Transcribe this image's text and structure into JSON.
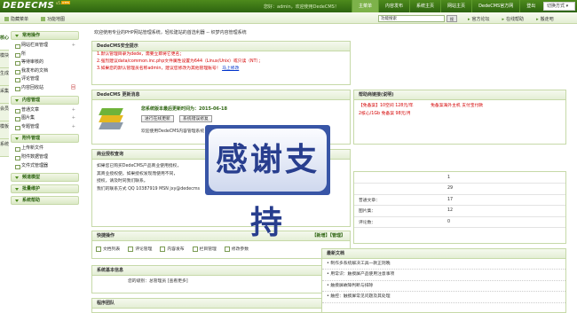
{
  "header": {
    "logo": "DEDECMS",
    "version": "v5.7",
    "badge": "UTF8",
    "user_info": "您好：admin，欢迎使用DedeCMS！",
    "nav": [
      "主菜单",
      "内容发布",
      "系统主页",
      "网站主页",
      "DedeCMS官方网",
      "登出"
    ],
    "active_nav_index": 0,
    "switch_label": "切换方式",
    "colors": {
      "brand": "#3a7a18",
      "accent": "#d40000",
      "link": "#0033cc"
    }
  },
  "toolbar": {
    "hide_menu": "隐藏菜单",
    "sitemap": "功能地图",
    "search_placeholder": "功能搜索",
    "search_button": "搜",
    "links": [
      "官方论坛",
      "在线帮助",
      "搬走吧"
    ]
  },
  "vtabs": [
    "核心",
    "模块",
    "生成",
    "采集",
    "会员",
    "模板",
    "系统"
  ],
  "sidebar": {
    "sections": [
      {
        "title": "常用操作",
        "items": [
          {
            "label": "网站栏目管理",
            "extra": "+"
          },
          {
            "label": "所",
            "extra": ""
          },
          {
            "label": "等待审核的",
            "extra": ""
          },
          {
            "label": "我发布的文档",
            "extra": ""
          },
          {
            "label": "评论管理",
            "extra": ""
          },
          {
            "label": "内容回收站",
            "extra": "回"
          }
        ]
      },
      {
        "title": "内容管理",
        "items": [
          {
            "label": "普通文章",
            "extra": "+"
          },
          {
            "label": "图片集",
            "extra": "+"
          },
          {
            "label": "专题管理",
            "extra": "+"
          }
        ]
      },
      {
        "title": "附件管理",
        "items": [
          {
            "label": "上传新文件",
            "extra": ""
          },
          {
            "label": "附件数据管理",
            "extra": ""
          },
          {
            "label": "文件式管理器",
            "extra": ""
          }
        ]
      },
      {
        "title": "频道模型",
        "items": []
      },
      {
        "title": "批量维护",
        "items": []
      },
      {
        "title": "系统帮助",
        "items": []
      }
    ]
  },
  "main": {
    "intro": "欢迎使用专业的PHP网站管理系统，轻松建站的首选利器 -- 织梦内容管理系统",
    "security": {
      "title": "DedeCMS安全提示",
      "lines": [
        "1.默认管理目录为dede，需要立即将它更名；",
        "2.强烈建议data/common.inc.php文件属性设置为644（Linux/Unix）或只读（NT）；",
        "3.如果您的默认管理员名称admin，建议您修改为其他管理账号！"
      ],
      "link": "马上修改"
    },
    "version": {
      "title": "DedeCMS 更新消息",
      "info": "您系统版本最后更新时间为：2015-06-18",
      "btn_check": "进行在线更新",
      "btn_fix": "系统错误修复",
      "footer": "欢迎使用DedeCMS内容管理系统"
    },
    "help_links": {
      "title": "帮助商链接(说明)",
      "rows": [
        {
          "left": "【免备案】10空间 128元/年",
          "right": "免备案海外主机 支付宝付款"
        },
        {
          "left": "2核心/1Gb 免备案 98元/月",
          "right": ""
        }
      ]
    },
    "business": {
      "title": "商业授权查询",
      "lines": [
        "如果您已购买DedeCMS产品商业使用授权，",
        "其商业授权使。如果授权发现而使用不同，",
        "授权，请及时同我们联系。",
        "我们的联系方式 QQ 10387919 MSN jxy@dedecms"
      ]
    },
    "stamp_text": "感谢支持",
    "stats": {
      "rows": [
        {
          "label": "",
          "value": "1"
        },
        {
          "label": "",
          "value": "29"
        },
        {
          "label": "普通文章：",
          "value": "17"
        },
        {
          "label": "图片集：",
          "value": "12"
        },
        {
          "label": "评论数：",
          "value": "0"
        }
      ]
    },
    "quick": {
      "title": "快捷操作",
      "actions": "【新增】【管理】",
      "links": [
        "文档列表",
        "评论管理",
        "内容发布",
        "栏目管理",
        "修改参数"
      ]
    },
    "sysinfo": {
      "title": "系统基本信息",
      "line": "您的级别：总管理员 [查看更多]"
    },
    "team": {
      "title": "程序团队"
    },
    "docs": {
      "title": "最新文档",
      "items": [
        "制作多系统解决工具一款正则晚",
        "用常识：触摸屏产品使用注意事项",
        "触摸屏故障判断与排除",
        "触控：触摸屏常见问题及其处理"
      ]
    }
  }
}
